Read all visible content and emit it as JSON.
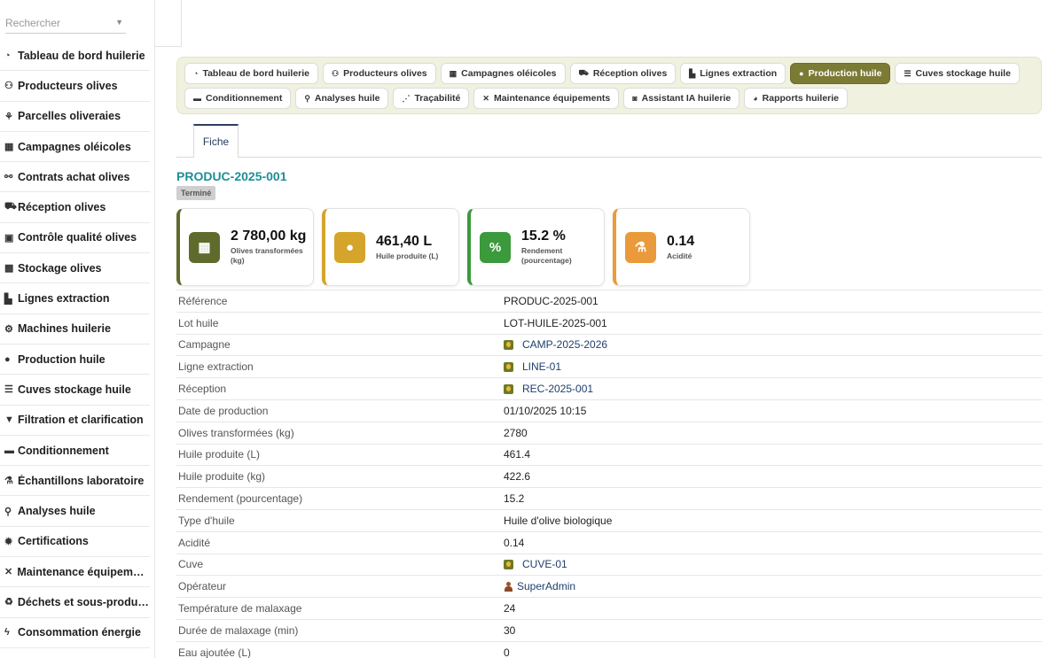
{
  "search": {
    "placeholder": "Rechercher"
  },
  "sidebar": {
    "items": [
      {
        "label": "Tableau de bord huilerie",
        "icon": "gauge-icon"
      },
      {
        "label": "Producteurs olives",
        "icon": "users-icon"
      },
      {
        "label": "Parcelles oliveraies",
        "icon": "seedling-icon"
      },
      {
        "label": "Campagnes oléicoles",
        "icon": "calendar-icon"
      },
      {
        "label": "Contrats achat olives",
        "icon": "handshake-icon"
      },
      {
        "label": "Réception olives",
        "icon": "truck-icon"
      },
      {
        "label": "Contrôle qualité olives",
        "icon": "clipboard-check-icon"
      },
      {
        "label": "Stockage olives",
        "icon": "boxes-icon"
      },
      {
        "label": "Lignes extraction",
        "icon": "industry-icon"
      },
      {
        "label": "Machines huilerie",
        "icon": "cogs-icon"
      },
      {
        "label": "Production huile",
        "icon": "oil-drop-icon"
      },
      {
        "label": "Cuves stockage huile",
        "icon": "database-icon"
      },
      {
        "label": "Filtration et clarification",
        "icon": "filter-icon"
      },
      {
        "label": "Conditionnement",
        "icon": "box-icon"
      },
      {
        "label": "Échantillons laboratoire",
        "icon": "flask-icon"
      },
      {
        "label": "Analyses huile",
        "icon": "microscope-icon"
      },
      {
        "label": "Certifications",
        "icon": "certificate-icon"
      },
      {
        "label": "Maintenance équipements",
        "icon": "tools-icon"
      },
      {
        "label": "Déchets et sous-produits",
        "icon": "recycle-icon"
      },
      {
        "label": "Consommation énergie",
        "icon": "bolt-icon"
      }
    ]
  },
  "nav": {
    "row1": [
      {
        "label": "Tableau de bord huilerie",
        "icon": "gauge-icon",
        "active": false
      },
      {
        "label": "Producteurs olives",
        "icon": "users-icon",
        "active": false
      },
      {
        "label": "Campagnes oléicoles",
        "icon": "calendar-icon",
        "active": false
      },
      {
        "label": "Réception olives",
        "icon": "truck-icon",
        "active": false
      },
      {
        "label": "Lignes extraction",
        "icon": "industry-icon",
        "active": false
      },
      {
        "label": "Production huile",
        "icon": "oil-drop-icon",
        "active": true
      },
      {
        "label": "Cuves stockage huile",
        "icon": "database-icon",
        "active": false
      }
    ],
    "row2": [
      {
        "label": "Conditionnement",
        "icon": "box-icon",
        "active": false
      },
      {
        "label": "Analyses huile",
        "icon": "microscope-icon",
        "active": false
      },
      {
        "label": "Traçabilité",
        "icon": "network-icon",
        "active": false
      },
      {
        "label": "Maintenance équipements",
        "icon": "tools-icon",
        "active": false
      },
      {
        "label": "Assistant IA huilerie",
        "icon": "robot-icon",
        "active": false
      },
      {
        "label": "Rapports huilerie",
        "icon": "pie-chart-icon",
        "active": false
      }
    ]
  },
  "tabs": {
    "fiche": "Fiche"
  },
  "record": {
    "title": "PRODUC-2025-001",
    "status": "Terminé"
  },
  "kpis": [
    {
      "value": "2 780,00 kg",
      "label": "Olives transformées (kg)",
      "icon": "boxes-icon",
      "color": "#5f6b2c"
    },
    {
      "value": "461,40 L",
      "label": "Huile produite (L)",
      "icon": "oil-drop-icon",
      "color": "#d4a52a"
    },
    {
      "value": "15.2 %",
      "label": "Rendement (pourcentage)",
      "icon": "percent-icon",
      "color": "#3b9a3c"
    },
    {
      "value": "0.14",
      "label": "Acidité",
      "icon": "flask-icon",
      "color": "#ea9a3a"
    }
  ],
  "colors": {
    "sidebar_bg": "#ffffff",
    "nav_panel_bg": "#f0f1df",
    "nav_active_bg": "#7c7b35",
    "title_teal": "#1d8f96",
    "link_blue": "#1f3f6e"
  },
  "details": [
    {
      "key": "Référence",
      "value": "PRODUC-2025-001",
      "type": "text"
    },
    {
      "key": "Lot huile",
      "value": "LOT-HUILE-2025-001",
      "type": "text"
    },
    {
      "key": "Campagne",
      "value": "CAMP-2025-2026",
      "type": "link"
    },
    {
      "key": "Ligne extraction",
      "value": "LINE-01",
      "type": "link"
    },
    {
      "key": "Réception",
      "value": "REC-2025-001",
      "type": "link"
    },
    {
      "key": "Date de production",
      "value": "01/10/2025 10:15",
      "type": "text"
    },
    {
      "key": "Olives transformées (kg)",
      "value": "2780",
      "type": "text"
    },
    {
      "key": "Huile produite (L)",
      "value": "461.4",
      "type": "text"
    },
    {
      "key": "Huile produite (kg)",
      "value": "422.6",
      "type": "text"
    },
    {
      "key": "Rendement (pourcentage)",
      "value": "15.2",
      "type": "text"
    },
    {
      "key": "Type d'huile",
      "value": "Huile d'olive biologique",
      "type": "text"
    },
    {
      "key": "Acidité",
      "value": "0.14",
      "type": "text"
    },
    {
      "key": "Cuve",
      "value": "CUVE-01",
      "type": "link"
    },
    {
      "key": "Opérateur",
      "value": "SuperAdmin",
      "type": "user"
    },
    {
      "key": "Température de malaxage",
      "value": "24",
      "type": "text"
    },
    {
      "key": "Durée de malaxage (min)",
      "value": "30",
      "type": "text"
    },
    {
      "key": "Eau ajoutée (L)",
      "value": "0",
      "type": "text"
    }
  ]
}
